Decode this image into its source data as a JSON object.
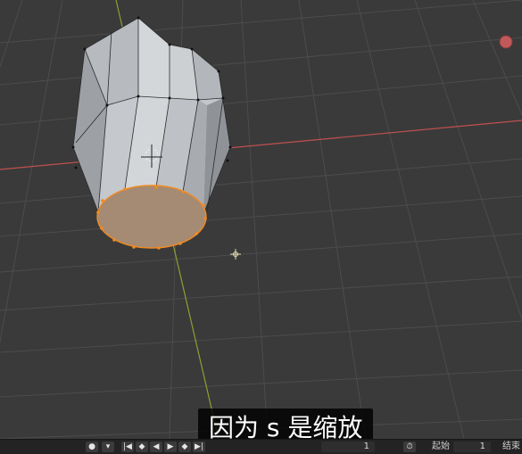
{
  "subtitle": {
    "text": "因为 s 是缩放"
  },
  "timeline": {
    "current_frame": "1",
    "start_label": "起始",
    "start_value": "1",
    "end_label": "结束"
  },
  "colors": {
    "x_axis": "#c05050",
    "y_axis": "#8aa036",
    "mesh_face": "#c8cbcf",
    "selected": "#f08a20",
    "selected_face": "#a58a74",
    "record": "#cc5555"
  },
  "icons": {
    "record_dot": "record-dot-icon",
    "jump_start": "jump-start-icon",
    "prev_keyframe": "prev-keyframe-icon",
    "play_reverse": "play-reverse-icon",
    "play": "play-icon",
    "next_keyframe": "next-keyframe-icon",
    "jump_end": "jump-end-icon",
    "stopwatch": "stopwatch-icon"
  }
}
